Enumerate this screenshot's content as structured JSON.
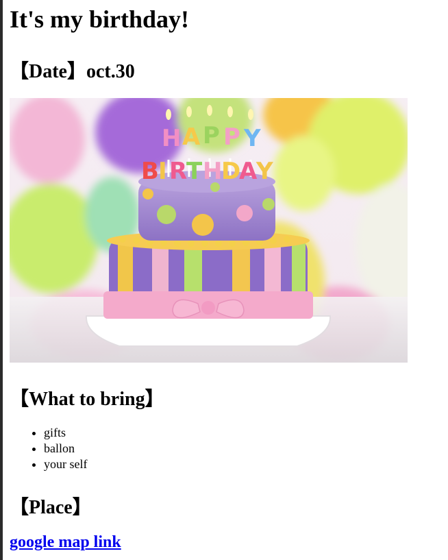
{
  "page": {
    "title": "It's my birthday!",
    "date_heading": "【Date】oct.30",
    "bring_heading": "【What to bring】",
    "bring_items": [
      "gifts",
      "ballon",
      "your self"
    ],
    "place_heading": "【Place】",
    "map_link_text": "google map link"
  },
  "image": {
    "alt": "birthday-cake-photo",
    "candle_letters_top": "HAPPY",
    "candle_letters_bottom": "BIRTHDAY"
  },
  "colors": {
    "link": "#0000ee",
    "text": "#000000"
  }
}
